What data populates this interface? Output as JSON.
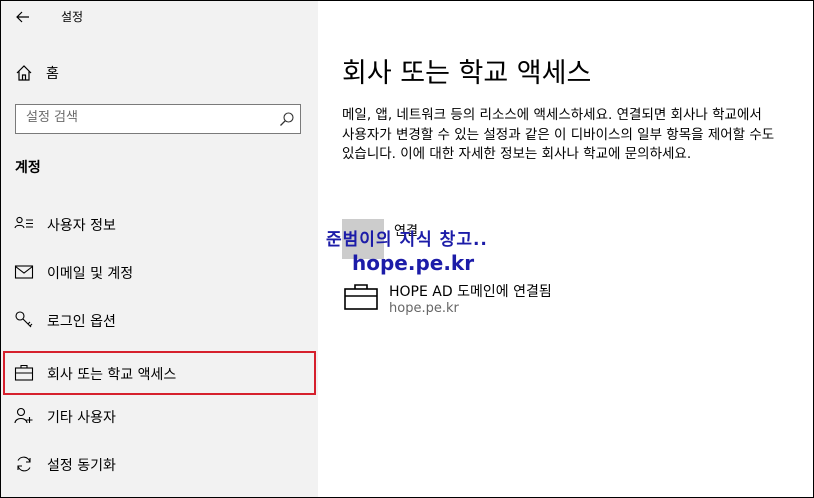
{
  "app_title": "설정",
  "home_label": "홈",
  "search": {
    "placeholder": "설정 검색"
  },
  "section_label": "계정",
  "nav": [
    {
      "label": "사용자 정보",
      "icon": "user-info-icon"
    },
    {
      "label": "이메일 및 계정",
      "icon": "mail-icon"
    },
    {
      "label": "로그인 옵션",
      "icon": "key-icon"
    },
    {
      "label": "회사 또는 학교 액세스",
      "icon": "briefcase-icon",
      "selected": true
    },
    {
      "label": "기타 사용자",
      "icon": "add-user-icon"
    },
    {
      "label": "설정 동기화",
      "icon": "sync-icon"
    }
  ],
  "main": {
    "title": "회사 또는 학교 액세스",
    "description": "메일, 앱, 네트워크 등의 리소스에 액세스하세요. 연결되면 회사나 학교에서 사용자가 변경할 수 있는 설정과 같은 이 디바이스의 일부 항목을 제어할 수도 있습니다. 이에 대한 자세한 정보는 회사나 학교에 문의하세요.",
    "connect_label": "연결",
    "account": {
      "title": "HOPE AD 도메인에 연결됨",
      "subtitle": "hope.pe.kr"
    }
  },
  "watermark": {
    "line1": "준범이의 지식 창고..",
    "line2": "hope.pe.kr"
  },
  "colors": {
    "sidebar_bg": "#f2f2f2",
    "selection_outline": "#d6202d",
    "watermark": "#1c1ca8"
  }
}
